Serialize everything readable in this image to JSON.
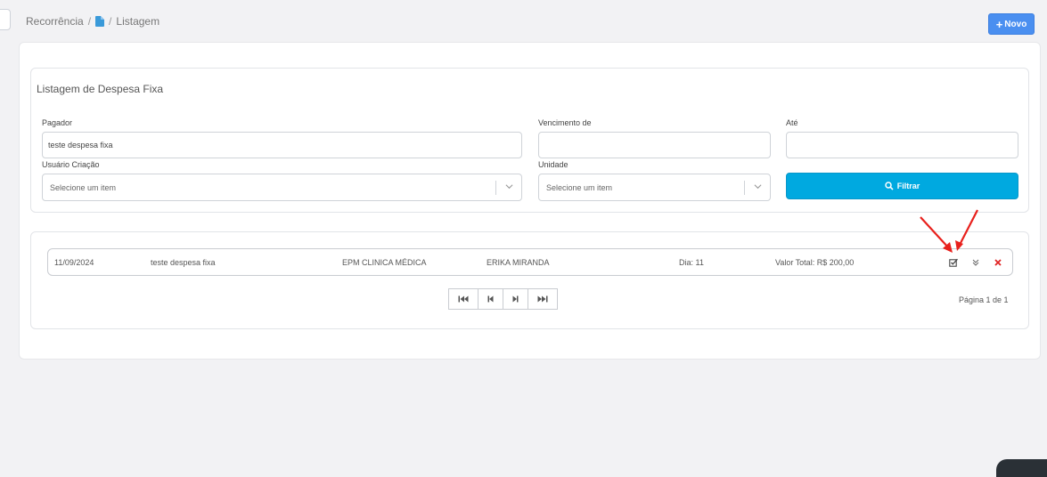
{
  "breadcrumb": {
    "root": "Recorrência",
    "sep1": "/",
    "sep2": "/",
    "current": "Listagem"
  },
  "header": {
    "new_button_label": "Novo"
  },
  "filter": {
    "title": "Listagem de Despesa Fixa",
    "pagador_label": "Pagador",
    "pagador_value": "teste despesa fixa",
    "vencimento_label": "Vencimento de",
    "vencimento_value": "",
    "ate_label": "Até",
    "ate_value": "",
    "usuario_label": "Usuário Criação",
    "usuario_placeholder": "Selecione um item",
    "unidade_label": "Unidade",
    "unidade_placeholder": "Selecione um item",
    "filter_button_label": "Filtrar"
  },
  "rows": [
    {
      "date": "11/09/2024",
      "pagador": "teste despesa fixa",
      "unidade": "EPM CLINICA MÉDICA",
      "usuario": "ERIKA MIRANDA",
      "dia": "Dia: 11",
      "valor": "Valor Total: R$ 200,00"
    }
  ],
  "pagination": {
    "info": "Página 1 de 1"
  },
  "colors": {
    "primary": "#4a8ff0",
    "filter": "#00a9e0",
    "delete": "#e02424",
    "arrow": "#e8201c"
  },
  "icons": [
    "file-icon",
    "plus-icon",
    "search-icon",
    "chevron-down-icon",
    "edit-check-icon",
    "double-chevron-down-icon",
    "close-icon",
    "first-page-icon",
    "prev-page-icon",
    "next-page-icon",
    "last-page-icon"
  ]
}
